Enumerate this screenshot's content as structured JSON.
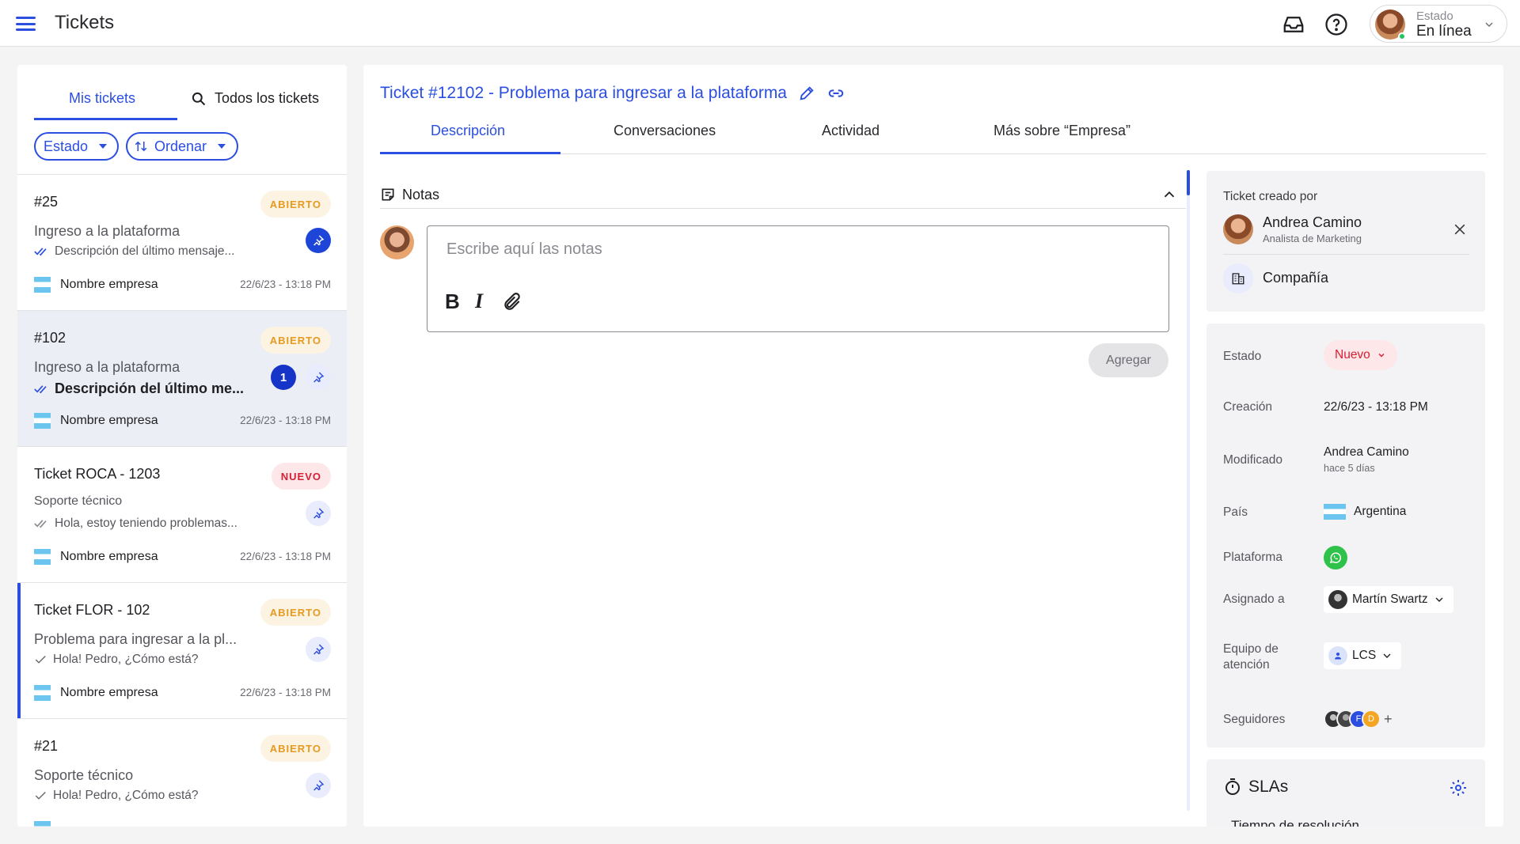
{
  "topbar": {
    "title": "Tickets",
    "status_label": "Estado",
    "status_value": "En línea"
  },
  "left": {
    "tabs": [
      "Mis tickets",
      "Todos los tickets"
    ],
    "filters": [
      "Estado",
      "Ordenar"
    ],
    "tickets": [
      {
        "title": "#25",
        "badge": "ABIERTO",
        "subject": "Ingreso a la plataforma",
        "message": "Descripción del último mensaje...",
        "company": "Nombre empresa",
        "date": "22/6/23 - 13:18 PM"
      },
      {
        "title": "#102",
        "badge": "ABIERTO",
        "subject": "Ingreso a la plataforma",
        "message": "Descripción del último me...",
        "unread": "1",
        "company": "Nombre empresa",
        "date": "22/6/23 - 13:18 PM"
      },
      {
        "title": "Ticket ROCA - 1203",
        "badge": "NUEVO",
        "subject": "Soporte técnico",
        "message": "Hola, estoy teniendo problemas...",
        "company": "Nombre empresa",
        "date": "22/6/23 - 13:18 PM"
      },
      {
        "title": "Ticket FLOR - 102",
        "badge": "ABIERTO",
        "subject": "Problema para ingresar a la pl...",
        "message": "Hola! Pedro, ¿Cómo está?",
        "company": "Nombre empresa",
        "date": "22/6/23 - 13:18 PM"
      },
      {
        "title": "#21",
        "badge": "ABIERTO",
        "subject": "Soporte técnico",
        "message": "Hola! Pedro, ¿Cómo está?"
      }
    ]
  },
  "main": {
    "heading": "Ticket #12102 - Problema para ingresar a la plataforma",
    "tabs": [
      "Descripción",
      "Conversaciones",
      "Actividad",
      "Más sobre “Empresa”"
    ],
    "notes_title": "Notas",
    "notes_placeholder": "Escribe aquí las notas",
    "notes_value": "",
    "add_label": "Agregar"
  },
  "creator": {
    "label": "Ticket creado por",
    "name": "Andrea Camino",
    "role": "Analista de Marketing",
    "company": "Compañía"
  },
  "details": {
    "estado_label": "Estado",
    "estado_value": "Nuevo",
    "creacion_label": "Creación",
    "creacion_value": "22/6/23 - 13:18 PM",
    "modificado_label": "Modificado",
    "modificado_by": "Andrea Camino",
    "modificado_when": "hace 5 días",
    "pais_label": "País",
    "pais_value": "Argentina",
    "plataforma_label": "Plataforma",
    "asignado_label": "Asignado a",
    "asignado_value": "Martín Swartz",
    "equipo_label_1": "Equipo de",
    "equipo_label_2": "atención",
    "equipo_value": "LCS",
    "seguidores_label": "Seguidores",
    "follower_initials": [
      "F",
      "D"
    ]
  },
  "sla": {
    "title": "SLAs",
    "sub": "Tiempo de resolución"
  },
  "colors": {
    "accent": "#2b4ee0",
    "open_badge": "#e79a1f",
    "new_badge": "#d62033",
    "online": "#22c55e",
    "whatsapp": "#2fc24a"
  }
}
